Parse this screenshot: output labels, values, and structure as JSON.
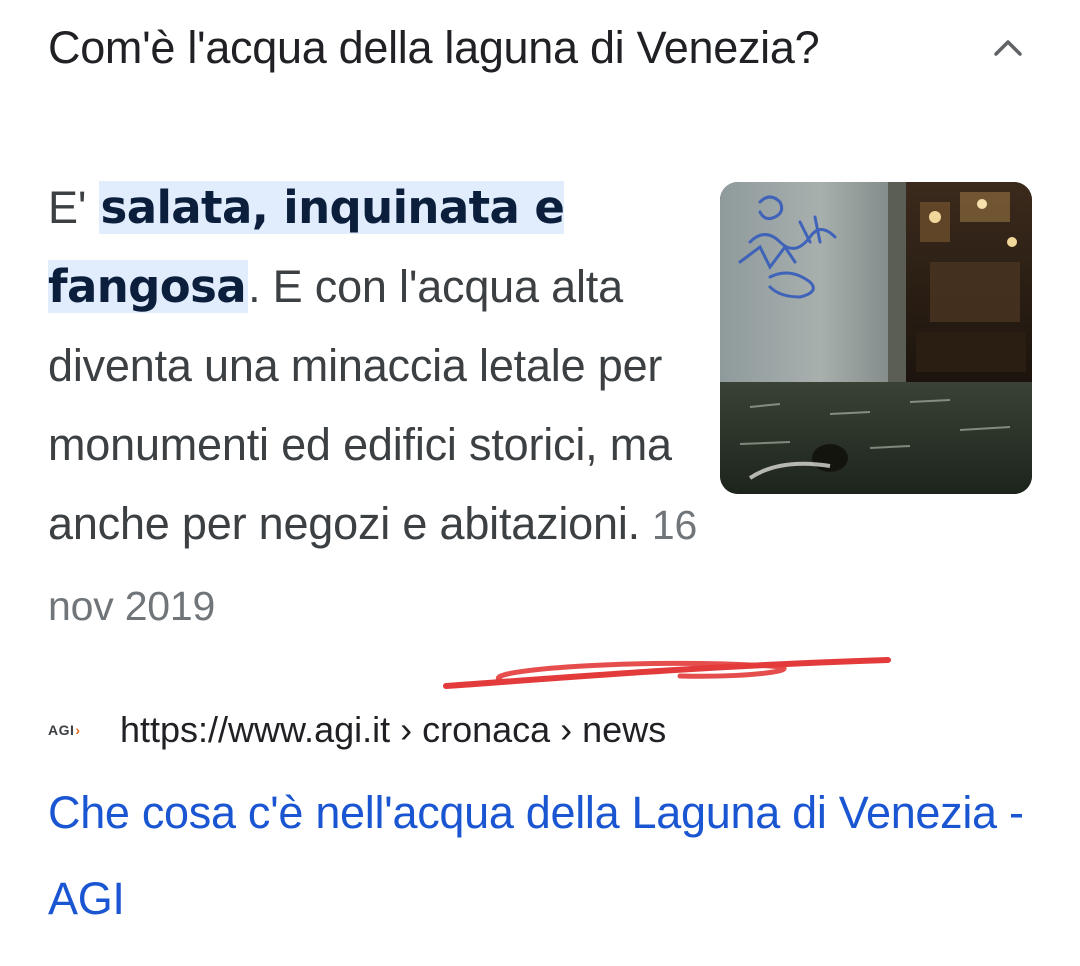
{
  "question": {
    "text": "Com'è l'acqua della laguna di Venezia?",
    "toggle_icon": "chevron-up-icon"
  },
  "snippet": {
    "prefix": "E' ",
    "highlight": "salata, inquinata e fangosa",
    "body": ". E con l'acqua alta diventa una minaccia letale per monumenti ed edifici storici, ma anche per negozi e abitazioni.",
    "date": "16 nov 2019"
  },
  "thumbnail": {
    "icon": "flooded-street-image"
  },
  "source": {
    "favicon_text": "AGI",
    "favicon_arrow": "›",
    "url": "https://www.agi.it › cronaca › news"
  },
  "result": {
    "title": "Che cosa c'è nell'acqua della Laguna di Venezia - AGI"
  },
  "colors": {
    "link": "#1a55d2",
    "highlight_bg": "#e1ecfc",
    "scribble": "#e33b3b"
  }
}
